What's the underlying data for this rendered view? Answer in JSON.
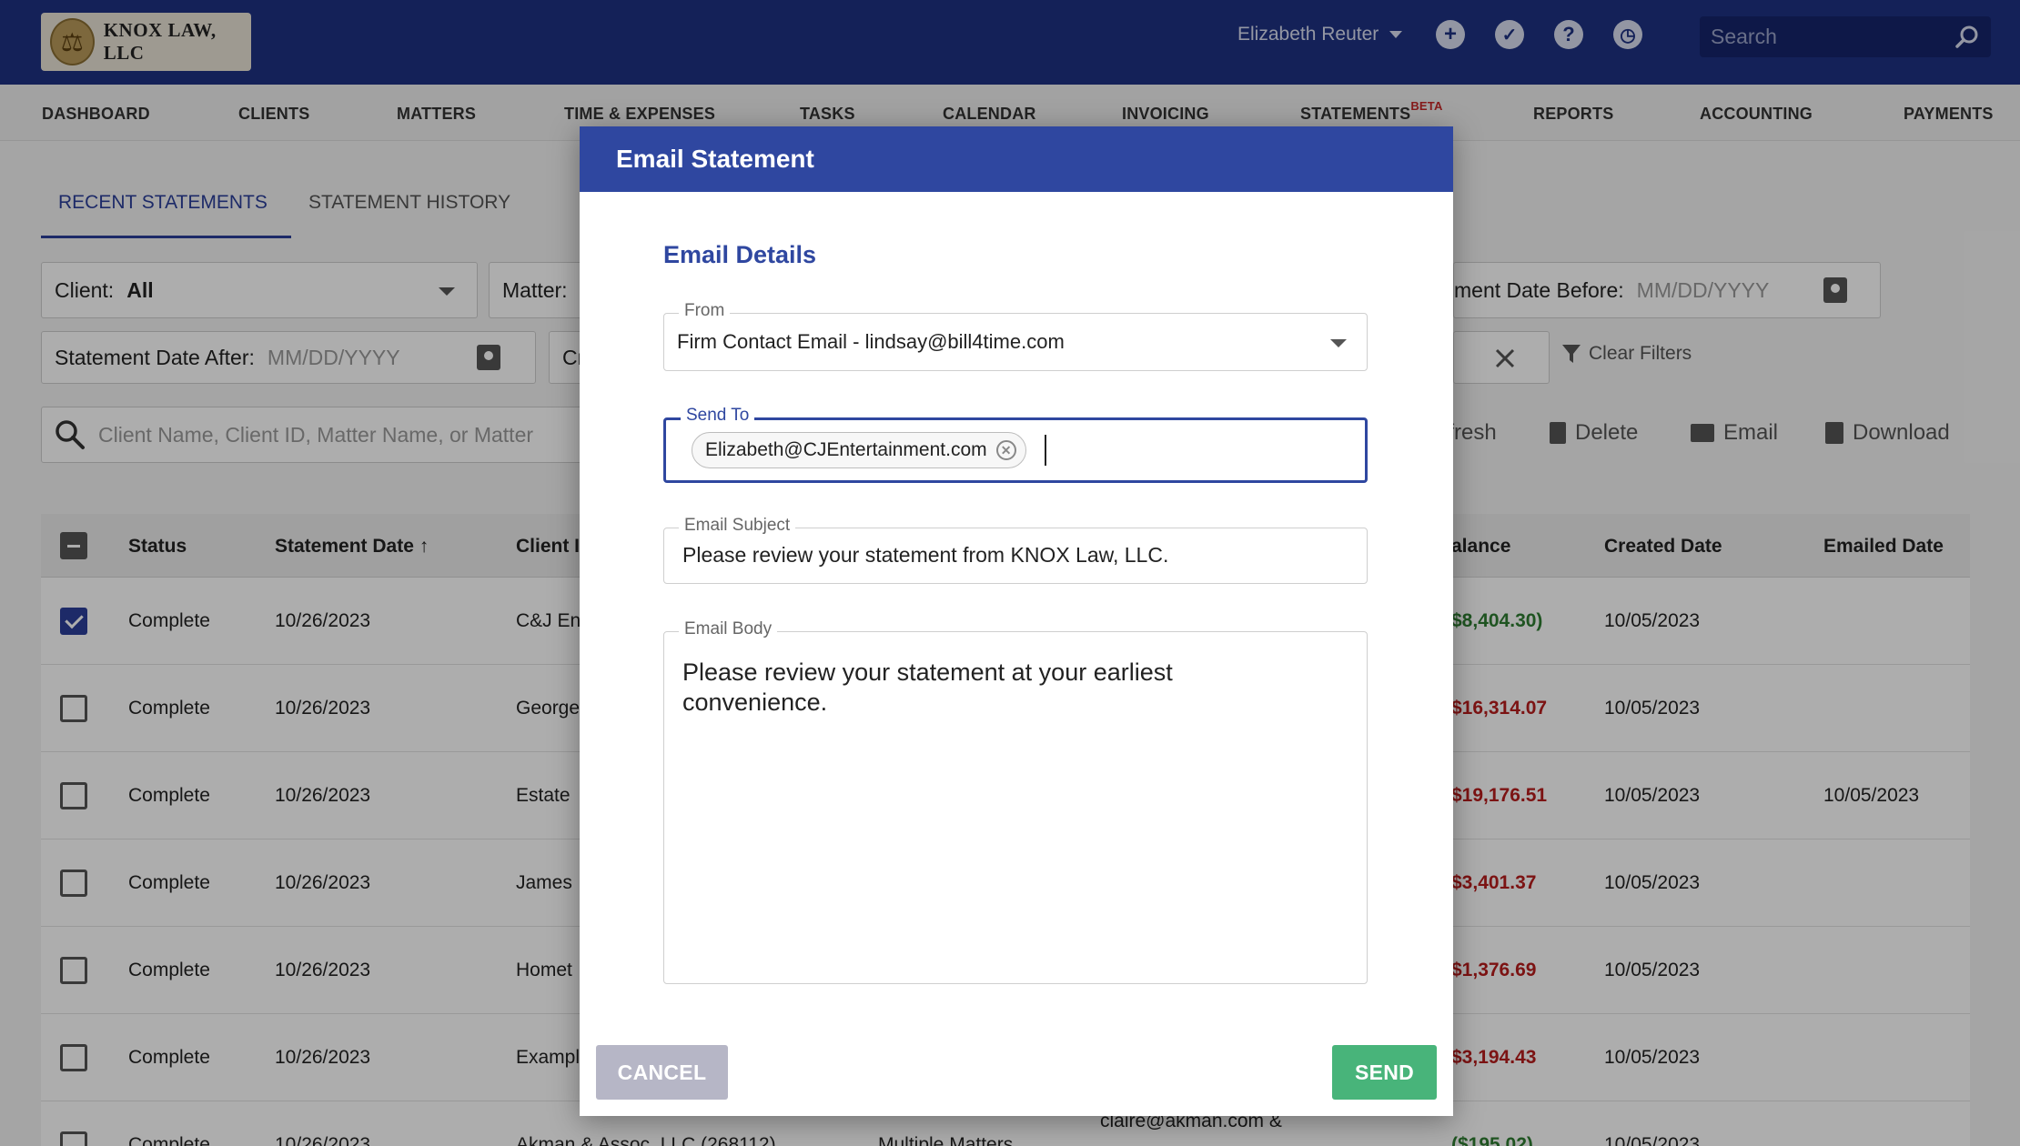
{
  "header": {
    "logo_text": "KNOX LAW, LLC",
    "user_name": "Elizabeth Reuter",
    "search_placeholder": "Search",
    "icons": [
      "add-icon",
      "check-circle-icon",
      "help-icon",
      "clock-icon",
      "search-icon"
    ]
  },
  "nav": {
    "items": [
      "DASHBOARD",
      "CLIENTS",
      "MATTERS",
      "TIME & EXPENSES",
      "TASKS",
      "CALENDAR",
      "INVOICING",
      "STATEMENTS",
      "REPORTS",
      "ACCOUNTING",
      "PAYMENTS"
    ],
    "beta_label": "BETA"
  },
  "tabs": {
    "recent": "RECENT STATEMENTS",
    "history": "STATEMENT HISTORY"
  },
  "filters": {
    "client_label": "Client:",
    "client_value": "All",
    "matter_label": "Matter:",
    "date_before_label": "ment Date Before:",
    "date_before_placeholder": "MM/DD/YYYY",
    "date_after_label": "Statement Date After:",
    "date_after_placeholder": "MM/DD/YYYY",
    "created_label_fragment": "Cr",
    "clear_filters": "Clear Filters",
    "search_placeholder": "Client Name, Client ID, Matter Name, or Matter"
  },
  "actions": {
    "refresh": "efresh",
    "delete": "Delete",
    "email": "Email",
    "download": "Download"
  },
  "table": {
    "headers": {
      "status": "Status",
      "statement_date": "Statement Date",
      "client": "Client I",
      "balance": "alance",
      "created_date": "Created Date",
      "emailed_date": "Emailed Date"
    },
    "rows": [
      {
        "status": "Complete",
        "date": "10/26/2023",
        "client": "C&J En",
        "balance": "$8,404.30)",
        "created": "10/05/2023",
        "emailed": ""
      },
      {
        "status": "Complete",
        "date": "10/26/2023",
        "client": "George",
        "balance": "$16,314.07",
        "created": "10/05/2023",
        "emailed": ""
      },
      {
        "status": "Complete",
        "date": "10/26/2023",
        "client": "Estate",
        "balance": "$19,176.51",
        "created": "10/05/2023",
        "emailed": "10/05/2023"
      },
      {
        "status": "Complete",
        "date": "10/26/2023",
        "client": "James",
        "balance": "$3,401.37",
        "created": "10/05/2023",
        "emailed": ""
      },
      {
        "status": "Complete",
        "date": "10/26/2023",
        "client": "Homet",
        "balance": "$1,376.69",
        "created": "10/05/2023",
        "emailed": ""
      },
      {
        "status": "Complete",
        "date": "10/26/2023",
        "client": "Exampl",
        "balance": "$3,194.43",
        "created": "10/05/2023",
        "emailed": ""
      },
      {
        "status": "Complete",
        "date": "10/26/2023",
        "client": "Akman & Assoc, LLC (268112)",
        "matter": "Multiple Matters",
        "email": "claire@akman.com &",
        "balance": "($195.02)",
        "created": "10/05/2023",
        "emailed": ""
      }
    ]
  },
  "modal": {
    "title": "Email Statement",
    "section": "Email Details",
    "from_label": "From",
    "from_value": "Firm Contact Email - lindsay@bill4time.com",
    "send_to_label": "Send To",
    "send_to_chip": "Elizabeth@CJEntertainment.com",
    "subject_label": "Email Subject",
    "subject_value": "Please review your statement from KNOX Law, LLC.",
    "body_label": "Email Body",
    "body_value": "Please review your statement at your earliest convenience.",
    "cancel": "CANCEL",
    "send": "SEND"
  },
  "colors": {
    "header_bg": "#1e3282",
    "modal_header_bg": "#2f47a0",
    "send_button": "#48b47a",
    "cancel_button": "#b6b6c6",
    "negative_amount": "#b71c1c",
    "positive_amount": "#2e7d32"
  }
}
